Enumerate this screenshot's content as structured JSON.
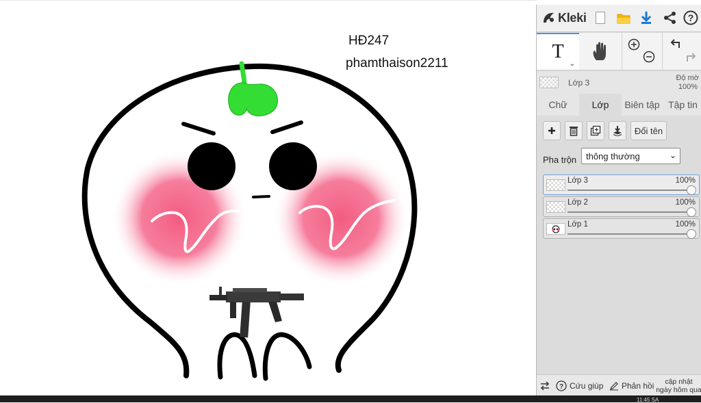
{
  "canvas": {
    "text_line1": "HĐ247",
    "text_line2": "phamthaison2211"
  },
  "app": {
    "name": "Kleki"
  },
  "top_icons": [
    "new-image-icon",
    "open-folder-icon",
    "download-icon",
    "share-icon",
    "help-icon"
  ],
  "tools": {
    "text_glyph": "T",
    "active": "text"
  },
  "layer_info": {
    "name": "Lớp 3",
    "opacity_label": "Độ mờ",
    "opacity_value": "100%"
  },
  "tabs": [
    "Chữ",
    "Lớp",
    "Biên tập",
    "Tập tin"
  ],
  "active_tab": "Lớp",
  "layer_buttons": {
    "rename": "Đổi tên"
  },
  "blend": {
    "label": "Pha trộn",
    "value": "thông thường"
  },
  "layers": [
    {
      "name": "Lớp 3",
      "opacity": "100%",
      "opacity_fraction": 1.0,
      "selected": true
    },
    {
      "name": "Lớp 2",
      "opacity": "100%",
      "opacity_fraction": 1.0,
      "selected": false
    },
    {
      "name": "Lớp 1",
      "opacity": "100%",
      "opacity_fraction": 1.0,
      "selected": false
    }
  ],
  "bottom": {
    "help": "Cứu giúp",
    "feedback": "Phản hồi",
    "update_line1": "cập nhật",
    "update_line2": "ngày hôm qua"
  },
  "taskbar": {
    "clock": "11:45 SA"
  },
  "colors": {
    "accent": "#4a90d9",
    "sprout": "#33dd33",
    "blush": "#f06080"
  }
}
